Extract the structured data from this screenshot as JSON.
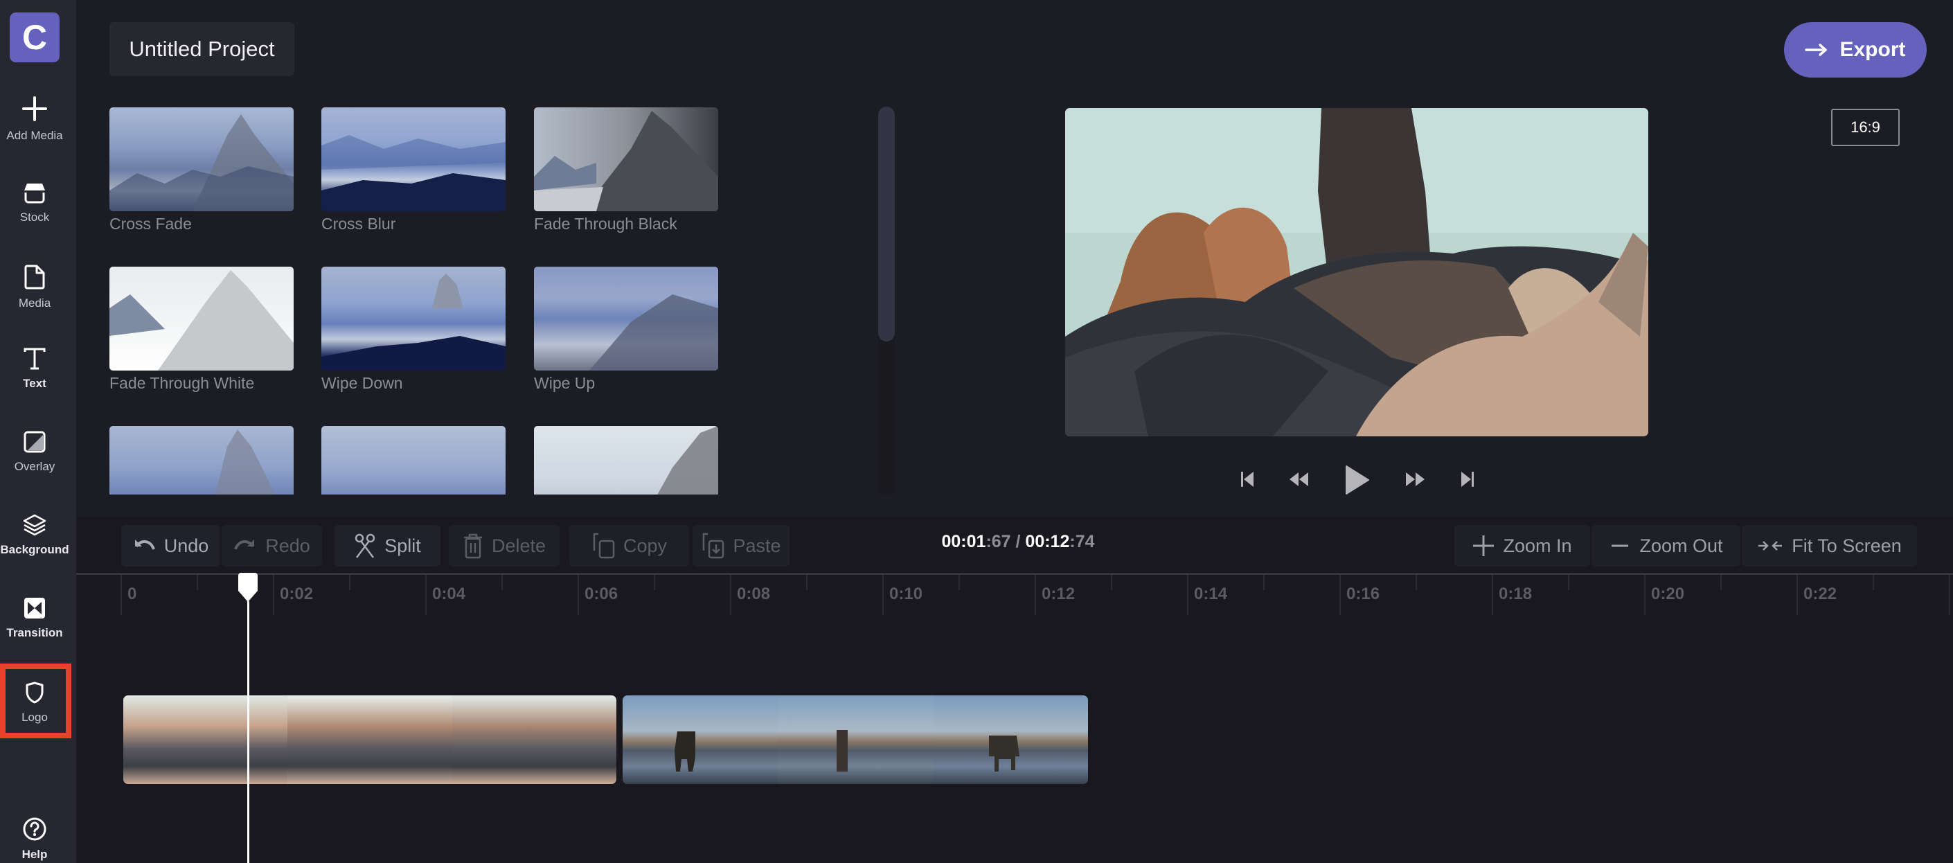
{
  "app": {
    "logo_letter": "C",
    "brand_color": "#6462bd",
    "highlight_color": "#e8432a"
  },
  "sidebar": {
    "items": [
      {
        "id": "add-media",
        "label": "Add Media",
        "icon": "plus-icon"
      },
      {
        "id": "stock",
        "label": "Stock",
        "icon": "stock-box-icon"
      },
      {
        "id": "media",
        "label": "Media",
        "icon": "file-icon"
      },
      {
        "id": "text",
        "label": "Text",
        "icon": "text-t-icon"
      },
      {
        "id": "overlay",
        "label": "Overlay",
        "icon": "overlay-square-icon"
      },
      {
        "id": "background",
        "label": "Background",
        "icon": "layers-icon"
      },
      {
        "id": "transition",
        "label": "Transition",
        "icon": "transition-bowtie-icon",
        "active": true
      },
      {
        "id": "logo",
        "label": "Logo",
        "icon": "shield-icon",
        "highlighted": true
      },
      {
        "id": "help",
        "label": "Help",
        "icon": "help-circle-icon"
      }
    ]
  },
  "header": {
    "project_title": "Untitled Project",
    "export_label": "Export",
    "export_icon": "arrow-right-icon",
    "aspect_ratio": "16:9"
  },
  "transitions": {
    "items": [
      {
        "label": "Cross Fade"
      },
      {
        "label": "Cross Blur"
      },
      {
        "label": "Fade Through Black"
      },
      {
        "label": "Fade Through White"
      },
      {
        "label": "Wipe Down"
      },
      {
        "label": "Wipe Up"
      },
      {
        "label": ""
      },
      {
        "label": ""
      },
      {
        "label": ""
      }
    ],
    "scroll_position_fraction": 0.0,
    "scroll_visible_fraction": 0.6
  },
  "preview": {
    "description": "Sea lions resting on rocks",
    "controls": [
      "skip-to-start-icon",
      "rewind-icon",
      "play-icon",
      "fast-forward-icon",
      "skip-to-end-icon"
    ]
  },
  "toolbar": {
    "undo": "Undo",
    "redo": "Redo",
    "split": "Split",
    "delete": "Delete",
    "copy": "Copy",
    "paste": "Paste",
    "zoom_in": "Zoom In",
    "zoom_out": "Zoom Out",
    "fit_to_screen": "Fit To Screen"
  },
  "time": {
    "current_main": "00:01",
    "current_frac": ":67",
    "separator": " / ",
    "total_main": "00:12",
    "total_frac": ":74"
  },
  "timeline": {
    "ruler_labels": [
      "0",
      "0:02",
      "0:04",
      "0:06",
      "0:08",
      "0:10",
      "0:12",
      "0:14",
      "0:16",
      "0:18",
      "0:20",
      "0:22"
    ],
    "playhead_seconds": 1.67,
    "clips": [
      {
        "name": "Sea lions clip",
        "frames": 3
      },
      {
        "name": "Elephant in water clip",
        "frames": 3
      }
    ]
  }
}
